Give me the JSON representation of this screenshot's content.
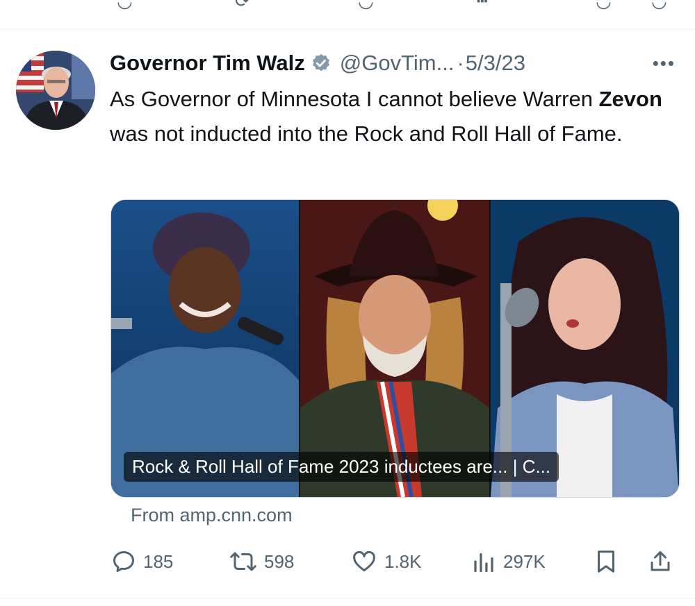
{
  "tweet": {
    "author_name": "Governor Tim Walz",
    "handle": "@GovTim...",
    "separator": "·",
    "date": "5/3/23",
    "more_label": "•••",
    "text_before": "As Governor of Minnesota I cannot believe Warren ",
    "text_bold": "Zevon",
    "text_after": " was not inducted into the Rock and Roll Hall of Fame."
  },
  "card": {
    "caption": "Rock & Roll Hall of Fame 2023 inductees are... | C...",
    "source": "From amp.cnn.com"
  },
  "actions": {
    "replies": "185",
    "retweets": "598",
    "likes": "1.8K",
    "views": "297K"
  },
  "icons": {
    "verified": "verified-badge-icon",
    "reply": "reply-icon",
    "retweet": "retweet-icon",
    "like": "heart-icon",
    "views": "views-icon",
    "bookmark": "bookmark-icon",
    "share": "share-icon"
  },
  "colors": {
    "text": "#0f1419",
    "secondary": "#536471",
    "verified": "#829aab",
    "divider": "#eff3f4"
  }
}
